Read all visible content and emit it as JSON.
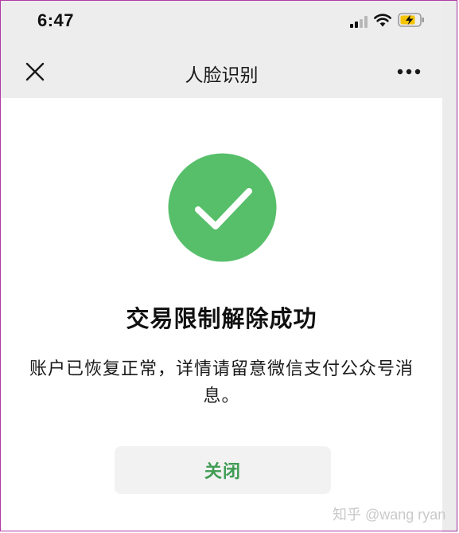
{
  "status_bar": {
    "time": "6:47",
    "icons": [
      "cellular-signal-icon",
      "wifi-icon",
      "battery-charging-icon"
    ],
    "battery_color": "#f5c400"
  },
  "nav_bar": {
    "title": "人脸识别",
    "left_icon": "close-icon",
    "right_icon": "more-icon"
  },
  "result": {
    "icon": "success-check-icon",
    "icon_color": "#57bf6a",
    "title": "交易限制解除成功",
    "description": "账户已恢复正常，详情请留意微信支付公众号消息。"
  },
  "actions": {
    "close_label": "关闭",
    "close_color": "#3f9c54"
  },
  "watermark": {
    "text": "知乎 @wang ryan"
  }
}
